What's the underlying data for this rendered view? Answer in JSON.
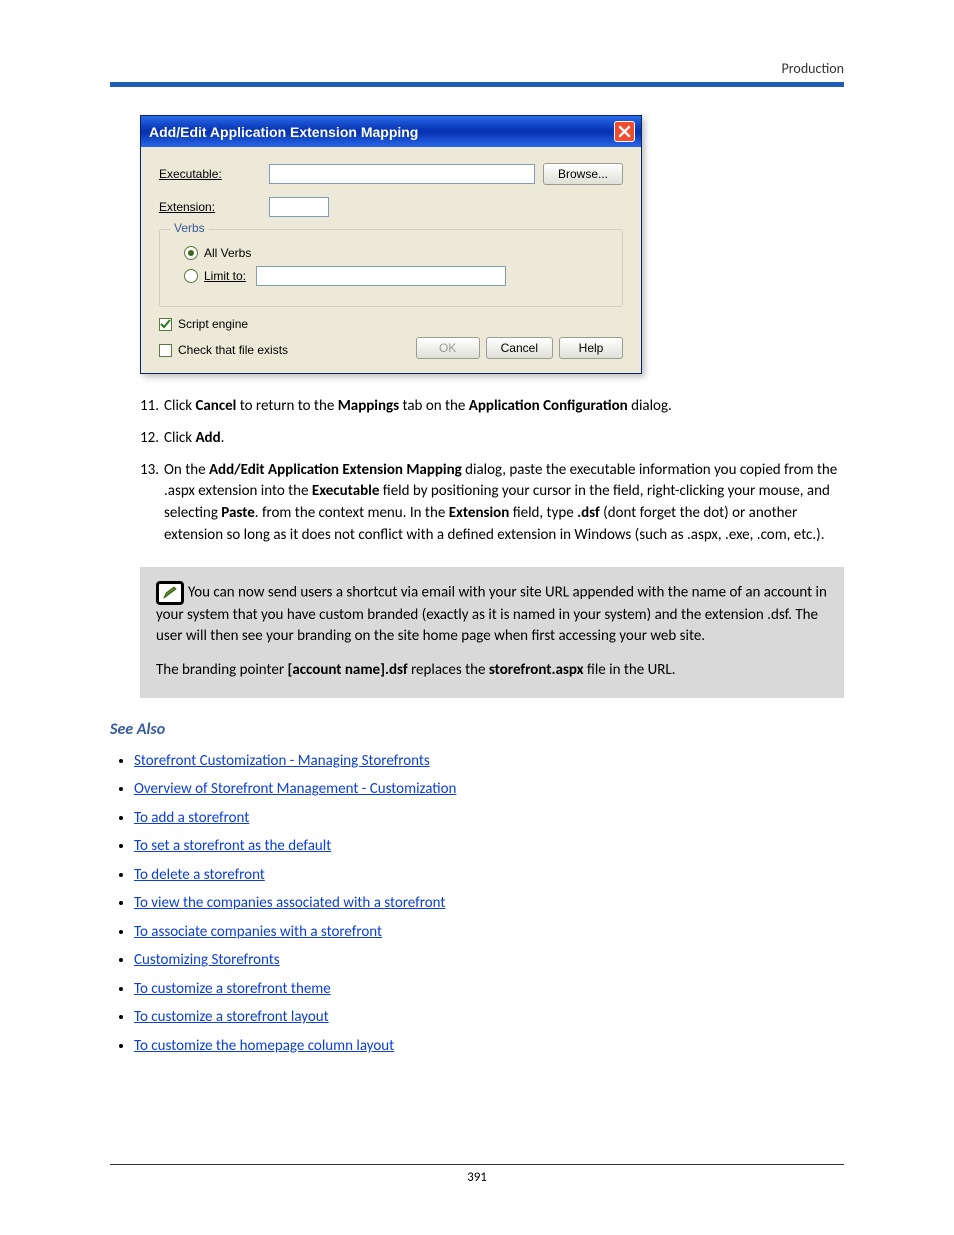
{
  "header": {
    "section": "Production"
  },
  "dialog": {
    "title": "Add/Edit Application Extension Mapping",
    "labels": {
      "executable": "Executable:",
      "extension": "Extension:",
      "verbs_legend": "Verbs",
      "all_verbs": "All Verbs",
      "limit_to": "Limit to:",
      "script_engine": "Script engine",
      "check_file_exists": "Check that file exists"
    },
    "buttons": {
      "browse": "Browse...",
      "ok": "OK",
      "cancel": "Cancel",
      "help": "Help"
    },
    "state": {
      "executable_value": "",
      "extension_value": "",
      "verbs_selected": "all",
      "limit_to_value": "",
      "script_engine_checked": true,
      "check_file_exists_checked": false
    }
  },
  "steps": {
    "s11": {
      "num": "11.",
      "a": "Click ",
      "b": "Cancel",
      "c": " to return to the ",
      "d": "Mappings",
      "e": " tab on the ",
      "f": "Application Configuration",
      "g": " dialog."
    },
    "s12": {
      "num": "12.",
      "a": "Click ",
      "b": "Add",
      "c": "."
    },
    "s13": {
      "num": "13.",
      "a": "On the ",
      "b": "Add/Edit Application Extension Mapping",
      "c": " dialog, paste the executable information you copied from the .aspx extension into the ",
      "d": "Executable",
      "e": " field by positioning your cursor in the field, right-clicking your mouse, and selecting ",
      "f": "Paste",
      "g": ". from the context menu. In the ",
      "h": "Extension",
      "i": " field, type ",
      "j": ".dsf",
      "k": " (dont forget the dot) or another extension so long as it does not conflict with a defined extension in Windows (such as .aspx, .exe, .com, etc.)."
    }
  },
  "note": {
    "p1": "You can now send users a shortcut via email with your site URL appended with the name of an account in your system that you have custom branded (exactly as it is named in your system) and the extension .dsf. The user will then see your branding on the site home page when first accessing your web site.",
    "p2a": "The branding pointer ",
    "p2b": "[account name].dsf",
    "p2c": " replaces the ",
    "p2d": "storefront.aspx",
    "p2e": " file in the URL."
  },
  "see_also": {
    "heading": "See Also",
    "links": [
      "Storefront Customization - Managing Storefronts",
      "Overview of Storefront Management - Customization",
      "To add a storefront",
      "To set a storefront as the default",
      "To delete a storefront",
      "To view the companies associated with a storefront",
      "To associate companies with a storefront",
      "Customizing Storefronts",
      "To customize a storefront theme",
      "To customize a storefront layout",
      "To customize the homepage column layout"
    ]
  },
  "page_number": "391"
}
